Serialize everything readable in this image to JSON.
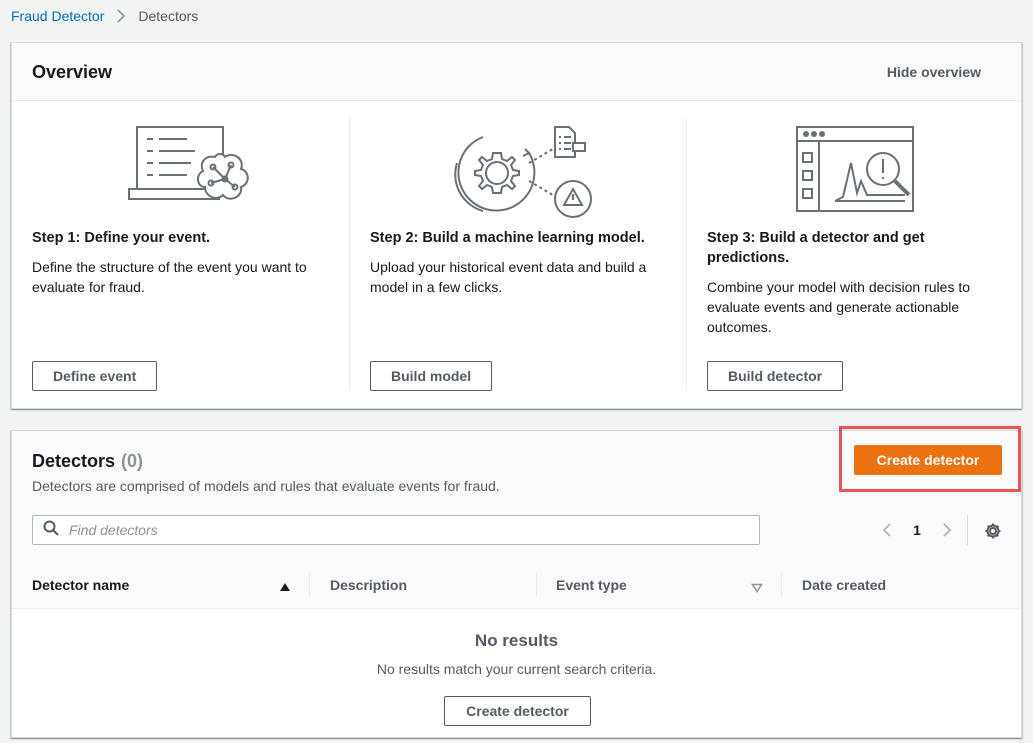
{
  "breadcrumb": {
    "items": [
      "Fraud Detector",
      "Detectors"
    ]
  },
  "overview": {
    "title": "Overview",
    "hide_label": "Hide overview",
    "steps": [
      {
        "title": "Step 1: Define your event.",
        "description": "Define the structure of the event you want to evaluate for fraud.",
        "button": "Define event",
        "icon": "laptop-brain-icon"
      },
      {
        "title": "Step 2: Build a machine learning model.",
        "description": "Upload your historical event data and build a model in a few clicks.",
        "button": "Build model",
        "icon": "gear-cycle-icon"
      },
      {
        "title": "Step 3: Build a detector and get predictions.",
        "description": "Combine your model with decision rules to evaluate events and generate actionable outcomes.",
        "button": "Build detector",
        "icon": "chart-magnifier-icon"
      }
    ]
  },
  "detectors": {
    "title": "Detectors",
    "count": "(0)",
    "description": "Detectors are comprised of models and rules that evaluate events for fraud.",
    "create_label": "Create detector",
    "search_placeholder": "Find detectors",
    "page": "1",
    "columns": [
      "Detector name",
      "Description",
      "Event type",
      "Date created"
    ],
    "empty_title": "No results",
    "empty_desc": "No results match your current search criteria.",
    "empty_button": "Create detector"
  },
  "colors": {
    "primary": "#ec7211",
    "link": "#0073bb",
    "highlight": "#ea5455"
  }
}
